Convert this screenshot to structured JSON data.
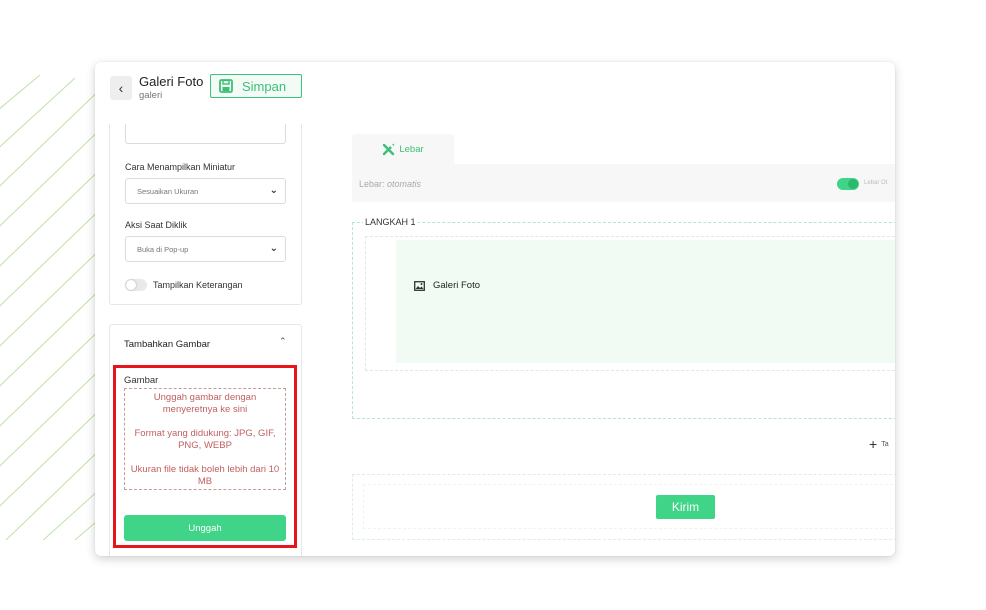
{
  "header": {
    "title": "Galeri Foto",
    "subtitle": "galeri",
    "save_label": "Simpan",
    "back_icon": "chevron-left-icon",
    "save_icon": "floppy-disk-icon"
  },
  "settings": {
    "thumbnail_label": "Cara Menampilkan Miniatur",
    "thumbnail_value": "Sesuaikan Ukuran",
    "click_action_label": "Aksi Saat Diklik",
    "click_action_value": "Buka di Pop-up",
    "show_caption_label": "Tampilkan Keterangan",
    "show_caption_on": false
  },
  "add_images": {
    "title": "Tambahkan Gambar",
    "field_label": "Gambar",
    "drop_line1": "Unggah gambar dengan menyeretnya ke sini",
    "drop_line2": "Format yang didukung: JPG, GIF, PNG, WEBP",
    "drop_line3": "Ukuran file tidak boleh lebih dari 10 MB",
    "upload_label": "Unggah"
  },
  "canvas": {
    "tab_label": "Lebar",
    "width_label": "Lebar:",
    "width_value": "otomatis",
    "auto_width_toggle_label": "Lebar Ot",
    "auto_width_on": true,
    "step_title": "LANGKAH 1",
    "block_label": "Galeri Foto",
    "add_label": "Ta",
    "submit_label": "Kirim"
  },
  "colors": {
    "accent": "#3fd488",
    "highlight": "#e8141b",
    "error_text": "#c15f5f"
  }
}
